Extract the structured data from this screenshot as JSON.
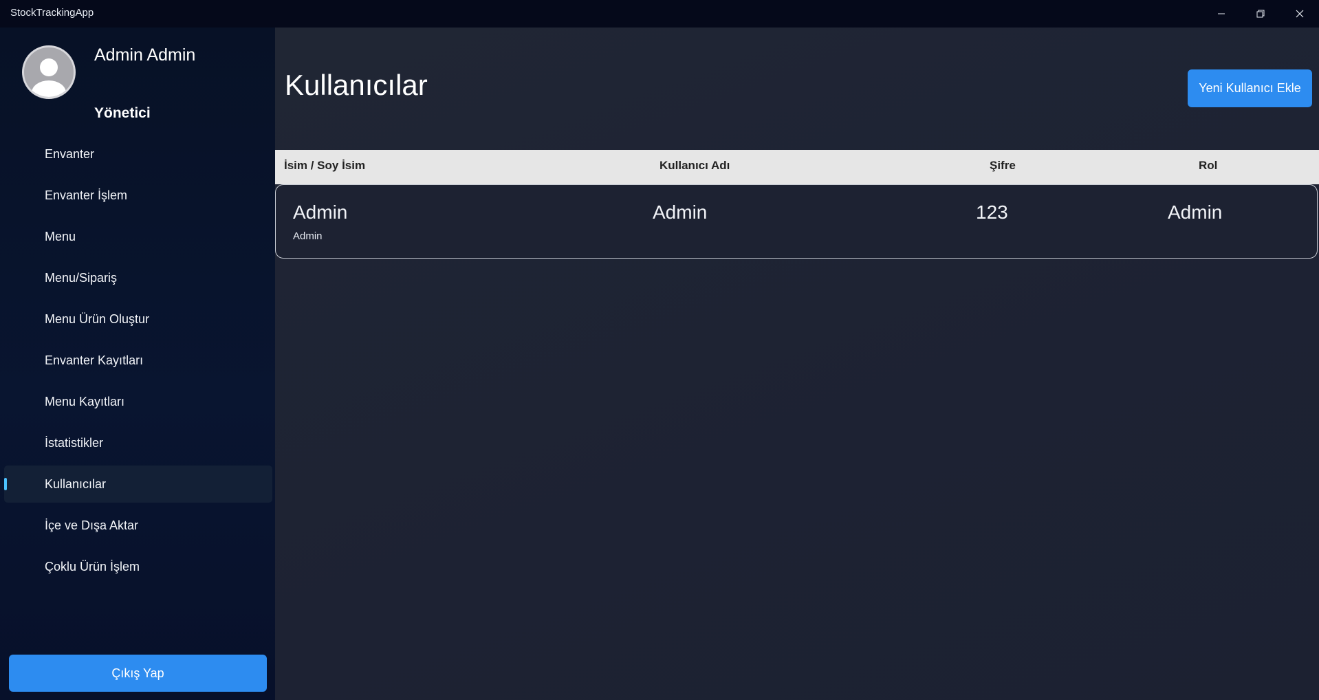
{
  "window": {
    "title": "StockTrackingApp",
    "controls": {
      "minimize": "minimize-icon",
      "maximize": "restore-icon",
      "close": "close-icon"
    }
  },
  "profile": {
    "name": "Admin Admin",
    "role": "Yönetici",
    "avatar_icon": "user-avatar-icon"
  },
  "sidebar": {
    "items": [
      {
        "label": "Envanter",
        "active": false
      },
      {
        "label": "Envanter İşlem",
        "active": false
      },
      {
        "label": "Menu",
        "active": false
      },
      {
        "label": "Menu/Sipariş",
        "active": false
      },
      {
        "label": "Menu Ürün Oluştur",
        "active": false
      },
      {
        "label": "Envanter Kayıtları",
        "active": false
      },
      {
        "label": "Menu Kayıtları",
        "active": false
      },
      {
        "label": "İstatistikler",
        "active": false
      },
      {
        "label": "Kullanıcılar",
        "active": true
      },
      {
        "label": "İçe ve Dışa Aktar",
        "active": false
      },
      {
        "label": "Çoklu Ürün İşlem",
        "active": false
      }
    ],
    "logout_label": "Çıkış Yap",
    "indicator_color": "#4cc2ff"
  },
  "main": {
    "title": "Kullanıcılar",
    "add_button_label": "Yeni Kullanıcı Ekle",
    "table": {
      "headers": {
        "name": "İsim / Soy İsim",
        "username": "Kullanıcı Adı",
        "password": "Şifre",
        "role": "Rol"
      },
      "rows": [
        {
          "name": "Admin",
          "surname": "Admin",
          "username": "Admin",
          "password": "123",
          "role": "Admin"
        }
      ]
    }
  },
  "colors": {
    "accent": "#2d8cf0",
    "sidebar_bg": "#071126",
    "main_bg": "#1f2433",
    "header_bg": "#e6e6e6"
  }
}
